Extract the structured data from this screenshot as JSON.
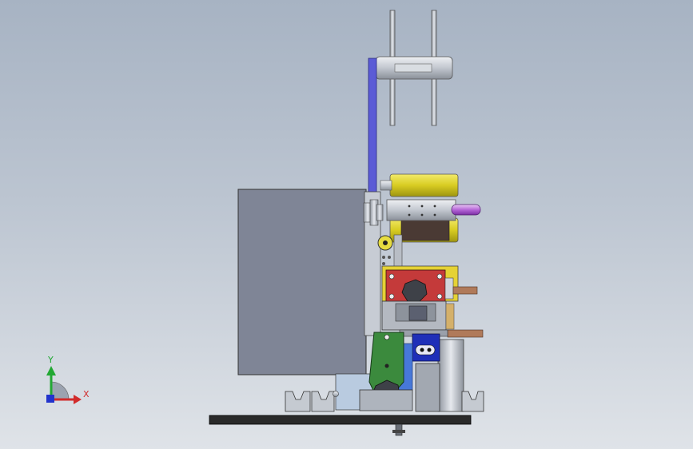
{
  "viewport": {
    "background_top": "#a7b3c3",
    "background_bottom": "#dfe3e8"
  },
  "triad": {
    "y_label": "Y",
    "x_label": "X",
    "y_color": "#22a833",
    "x_color": "#d12b2b",
    "z_color": "#2233cc"
  },
  "colors": {
    "housing": "#7f8596",
    "yellow_roller": "#e2d636",
    "red_block": "#c43a3a",
    "green_plate": "#3b8a3d",
    "blue_block": "#1f2fb8",
    "purple_belt": "#5b5bd6",
    "base_plate": "#2a2a2a"
  }
}
